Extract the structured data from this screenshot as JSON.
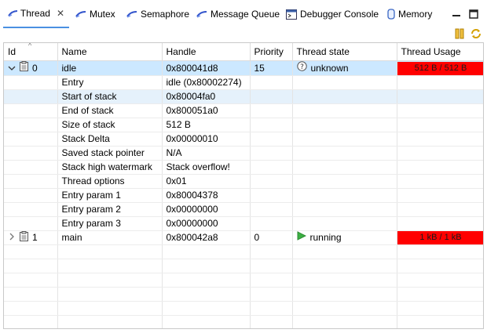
{
  "tabs": [
    {
      "label": "Thread",
      "active": true,
      "close": "✕"
    },
    {
      "label": "Mutex"
    },
    {
      "label": "Semaphore"
    },
    {
      "label": "Message Queue"
    },
    {
      "label": "Debugger Console"
    },
    {
      "label": "Memory"
    }
  ],
  "columns": {
    "id": "Id",
    "name": "Name",
    "handle": "Handle",
    "priority": "Priority",
    "state": "Thread state",
    "usage": "Thread Usage"
  },
  "threads": [
    {
      "id": "0",
      "name": "idle",
      "handle": "0x800041d8",
      "priority": "15",
      "state": "unknown",
      "usage": "512 B / 512 B"
    },
    {
      "id": "1",
      "name": "main",
      "handle": "0x800042a8",
      "priority": "0",
      "state": "running",
      "usage": "1 kB / 1 kB"
    }
  ],
  "details": [
    {
      "name": "Entry",
      "value": "idle (0x80002274)"
    },
    {
      "name": "Start of stack",
      "value": "0x80004fa0"
    },
    {
      "name": "End of stack",
      "value": "0x800051a0"
    },
    {
      "name": "Size of stack",
      "value": "512 B"
    },
    {
      "name": "Stack Delta",
      "value": "0x00000010"
    },
    {
      "name": "Saved stack pointer",
      "value": "N/A"
    },
    {
      "name": "Stack high watermark",
      "value": "Stack overflow!"
    },
    {
      "name": "Thread options",
      "value": "0x01"
    },
    {
      "name": "Entry param 1",
      "value": "0x80004378"
    },
    {
      "name": "Entry param 2",
      "value": "0x00000000"
    },
    {
      "name": "Entry param 3",
      "value": "0x00000000"
    }
  ],
  "colors": {
    "accent": "#4a90e2",
    "selection": "#cce8ff",
    "usage_full": "#ff0000",
    "running": "#3cb043"
  }
}
